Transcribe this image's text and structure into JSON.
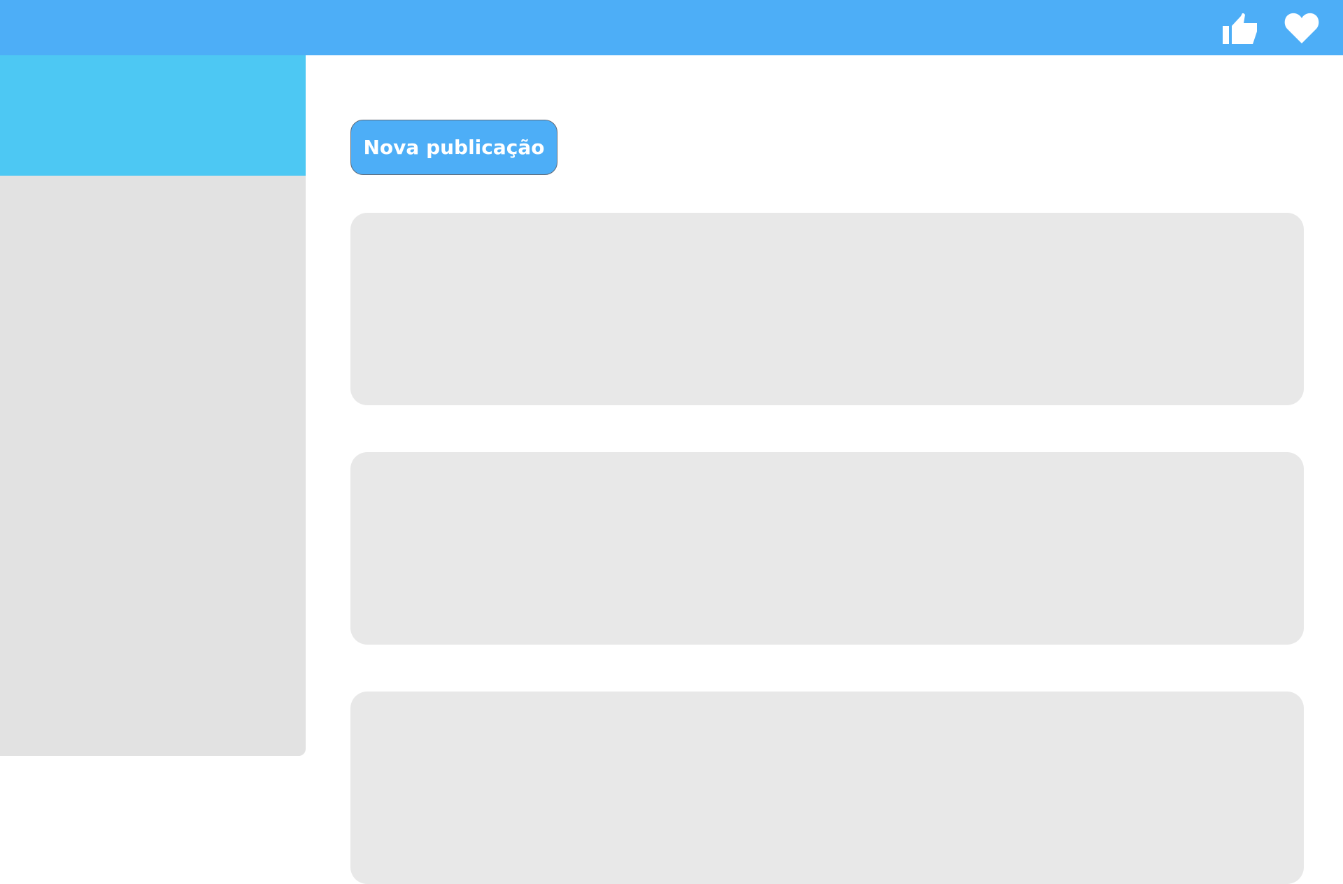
{
  "header": {
    "icons": [
      "thumbs-up-icon",
      "heart-icon"
    ],
    "background_color": "#4daef7"
  },
  "sidebar": {
    "header_color": "#4dc8f3",
    "background_color": "#e2e2e2"
  },
  "main": {
    "new_post_label": "Nova publicação",
    "posts": [
      {},
      {},
      {}
    ]
  },
  "colors": {
    "accent": "#4daef7",
    "card": "#e8e8e8"
  }
}
